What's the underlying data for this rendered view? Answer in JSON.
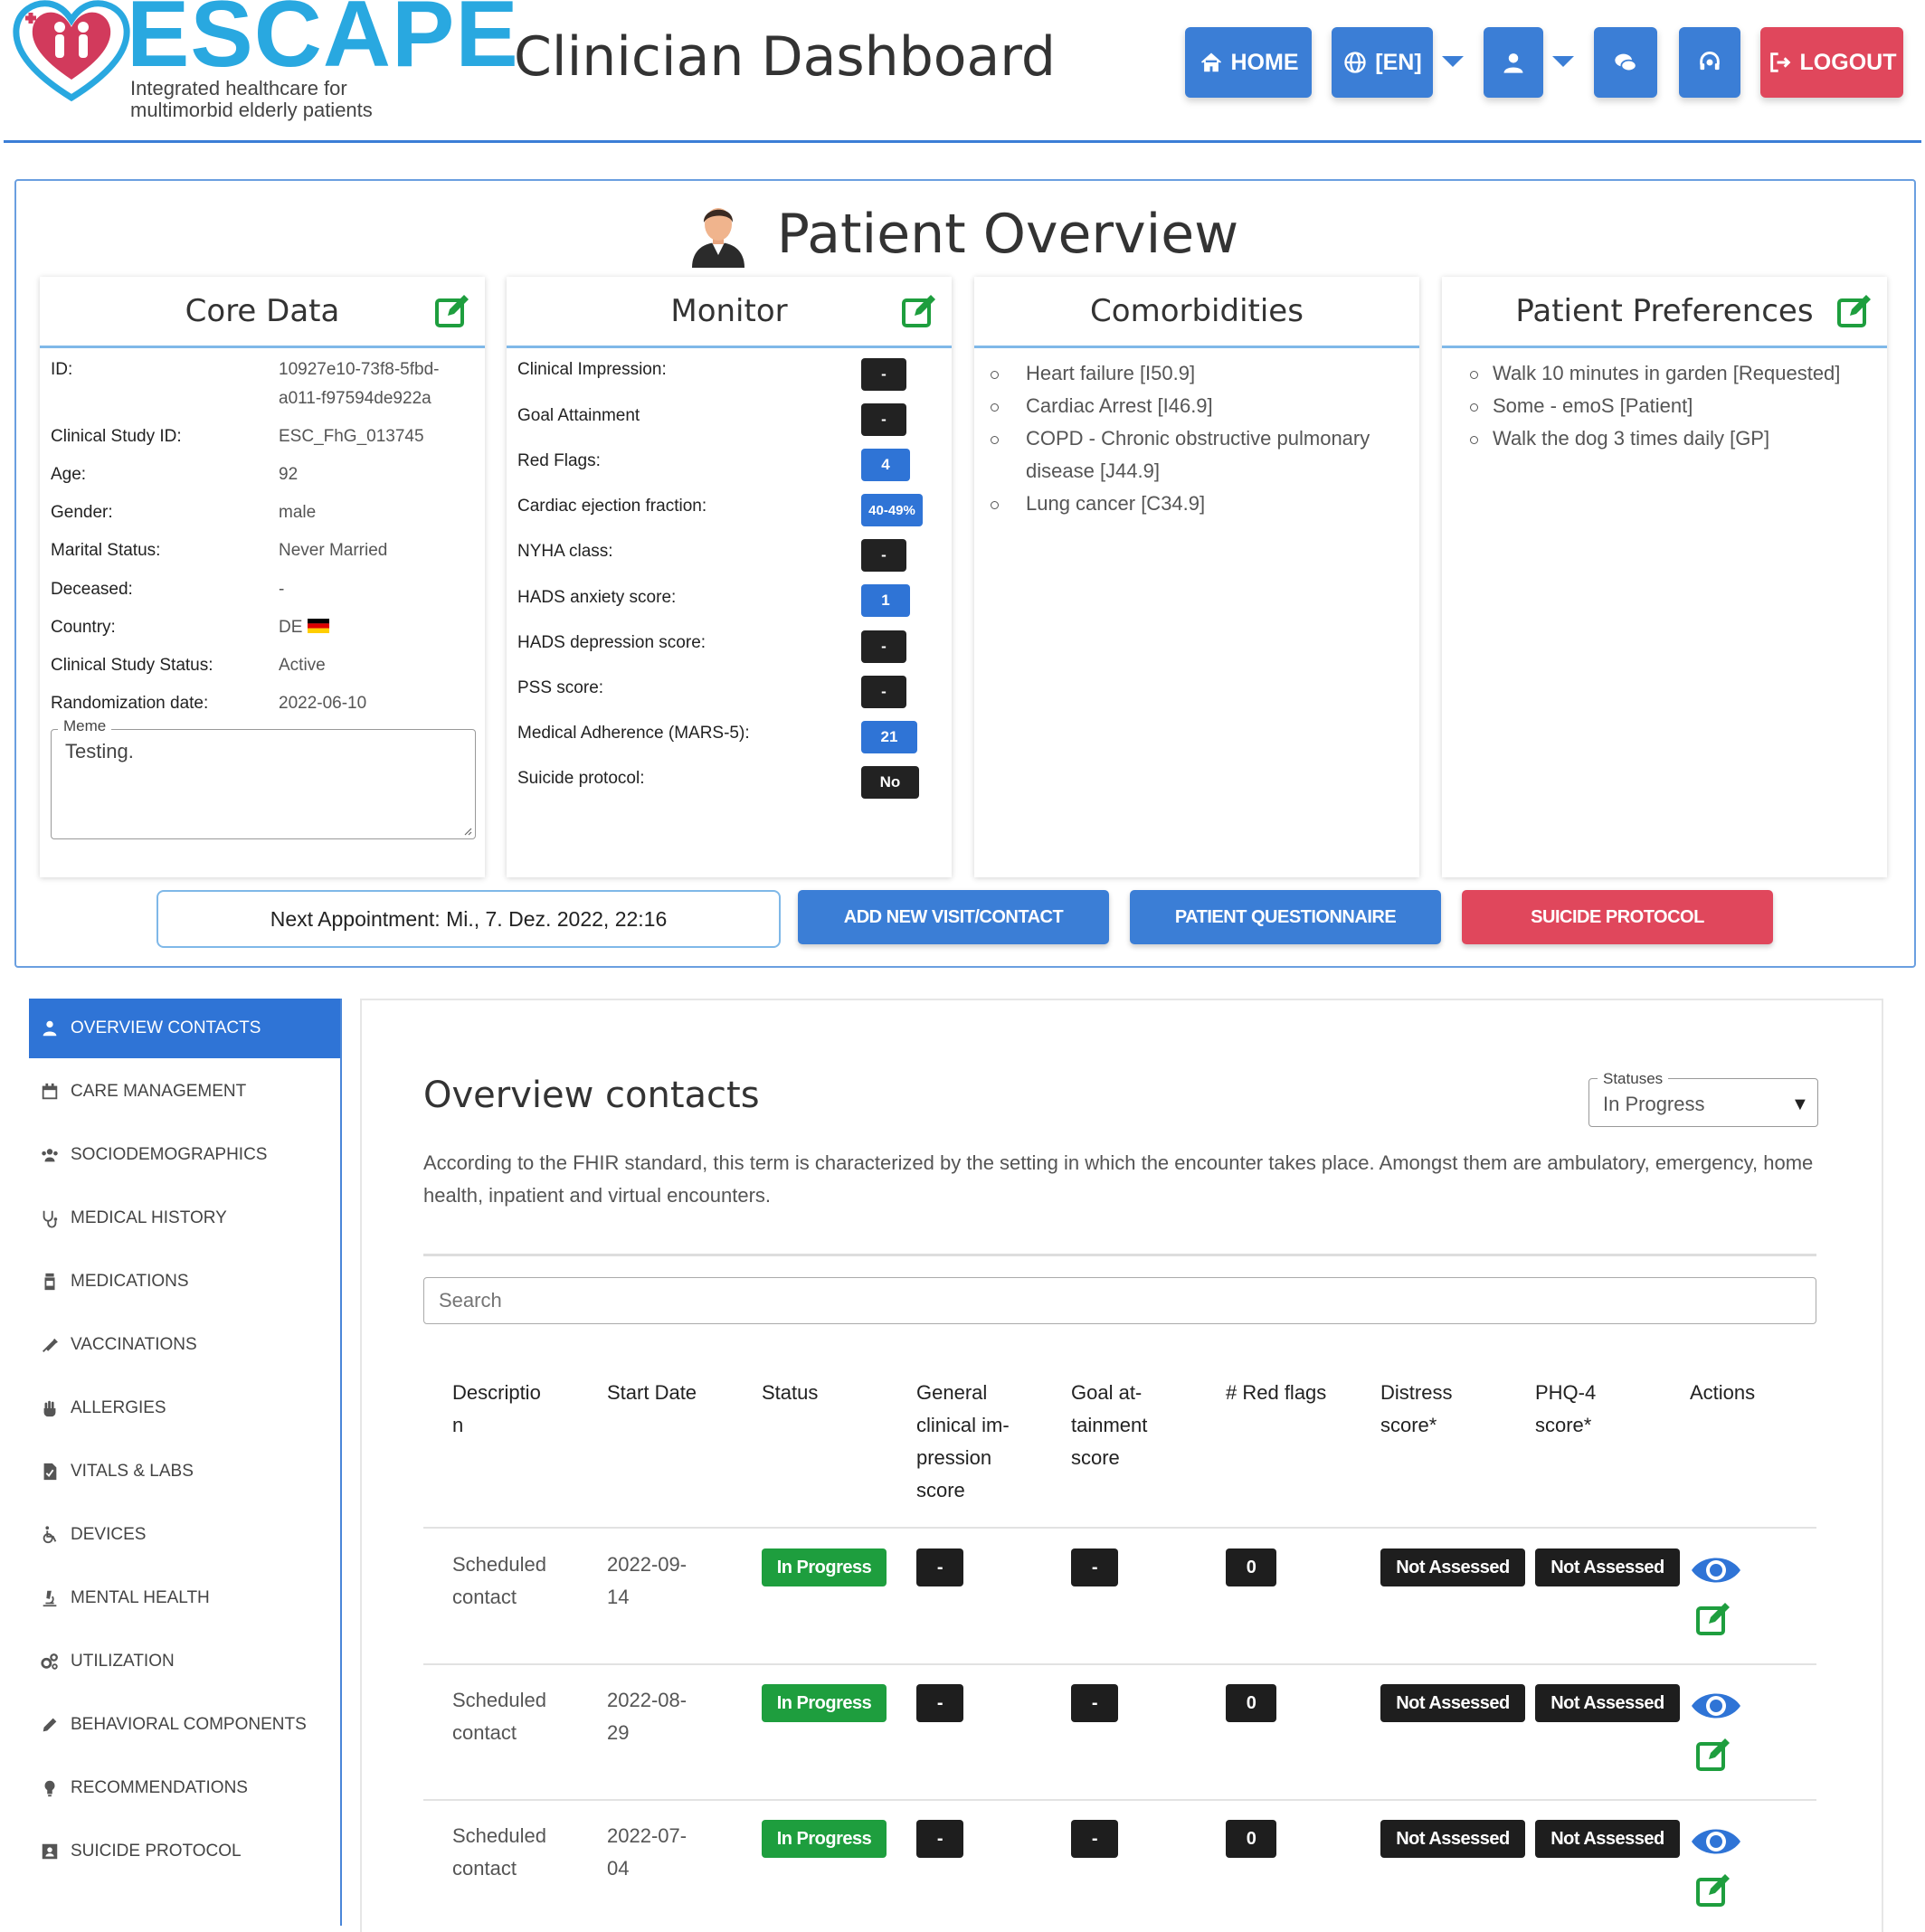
{
  "header": {
    "brand": "ESCAPE",
    "tagline_line1": "Integrated healthcare for",
    "tagline_line2": "multimorbid elderly patients",
    "title": "Clinician Dashboard",
    "home_label": "HOME",
    "language_label": "[EN]",
    "logout_label": "LOGOUT"
  },
  "colors": {
    "primary": "#3b7ed6",
    "brand_blue": "#29a8e0",
    "danger": "#e0475c",
    "success": "#1e9e3e",
    "dark_badge": "#222222"
  },
  "overview": {
    "title": "Patient Overview",
    "core": {
      "title": "Core Data",
      "rows": [
        {
          "label": "ID:",
          "value": "10927e10-73f8-5fbd-",
          "value2": "a011-f97594de922a"
        },
        {
          "label": "Clinical Study ID:",
          "value": "ESC_FhG_013745"
        },
        {
          "label": "Age:",
          "value": "92"
        },
        {
          "label": "Gender:",
          "value": "male"
        },
        {
          "label": "Marital Status:",
          "value": "Never Married"
        },
        {
          "label": "Deceased:",
          "value": "-"
        },
        {
          "label": "Country:",
          "value": "DE"
        },
        {
          "label": "Clinical Study Status:",
          "value": "Active"
        },
        {
          "label": "Randomization date:",
          "value": "2022-06-10"
        }
      ],
      "meme_label": "Meme",
      "meme_text": "Testing."
    },
    "monitor": {
      "title": "Monitor",
      "rows": [
        {
          "label": "Clinical Impression:",
          "value": "-"
        },
        {
          "label": "Goal Attainment",
          "value": "-"
        },
        {
          "label": "Red Flags:",
          "value": "4"
        },
        {
          "label": "Cardiac ejection fraction:",
          "value": "40-49%"
        },
        {
          "label": "NYHA class:",
          "value": "-"
        },
        {
          "label": "HADS anxiety score:",
          "value": "1"
        },
        {
          "label": "HADS depression score:",
          "value": "-"
        },
        {
          "label": "PSS score:",
          "value": "-"
        },
        {
          "label": "Medical Adherence (MARS-5):",
          "value": "21"
        },
        {
          "label": "Suicide protocol:",
          "value": "No"
        }
      ]
    },
    "comorbidities": {
      "title": "Comorbidities",
      "items": [
        "Heart failure [I50.9]",
        "Cardiac Arrest [I46.9]",
        "COPD - Chronic obstructive pulmonary",
        "disease [J44.9]",
        "Lung cancer [C34.9]"
      ]
    },
    "preferences": {
      "title": "Patient Preferences",
      "items": [
        "Walk 10 minutes in garden [Requested]",
        "Some - emoS [Patient]",
        "Walk the dog 3 times daily [GP]"
      ]
    },
    "next_appointment": "Next Appointment: Mi., 7. Dez. 2022, 22:16",
    "add_visit_label": "ADD NEW VISIT/CONTACT",
    "questionnaire_label": "PATIENT QUESTIONNAIRE",
    "suicide_label": "SUICIDE PROTOCOL"
  },
  "sidebar": {
    "items": [
      {
        "label": "OVERVIEW CONTACTS",
        "icon": "person-icon",
        "active": true
      },
      {
        "label": "CARE MANAGEMENT",
        "icon": "calendar-icon"
      },
      {
        "label": "SOCIODEMOGRAPHICS",
        "icon": "users-icon"
      },
      {
        "label": "MEDICAL HISTORY",
        "icon": "stethoscope-icon"
      },
      {
        "label": "MEDICATIONS",
        "icon": "pill-bottle-icon"
      },
      {
        "label": "VACCINATIONS",
        "icon": "syringe-icon"
      },
      {
        "label": "ALLERGIES",
        "icon": "hand-icon"
      },
      {
        "label": "VITALS & LABS",
        "icon": "lab-file-icon"
      },
      {
        "label": "DEVICES",
        "icon": "wheelchair-icon"
      },
      {
        "label": "MENTAL HEALTH",
        "icon": "microscope-icon"
      },
      {
        "label": "UTILIZATION",
        "icon": "gears-icon"
      },
      {
        "label": "BEHAVIORAL COMPONENTS",
        "icon": "pencil-icon"
      },
      {
        "label": "RECOMMENDATIONS",
        "icon": "lightbulb-icon"
      },
      {
        "label": "SUICIDE PROTOCOL",
        "icon": "id-card-icon"
      }
    ]
  },
  "contacts": {
    "title": "Overview contacts",
    "status_label": "Statuses",
    "status_value": "In Progress",
    "description": "According to the FHIR standard, this term is characterized by the setting in which the encounter takes place. Amongst them are ambulatory, emergency, home health, inpatient and virtual encounters.",
    "search_placeholder": "Search",
    "columns": [
      [
        "Descriptio",
        "n"
      ],
      [
        "Start Date"
      ],
      [
        "Status"
      ],
      [
        "General",
        "clinical im-",
        "pression",
        "score"
      ],
      [
        "Goal at-",
        "tainment",
        "score"
      ],
      [
        "# Red flags"
      ],
      [
        "Distress",
        "score*"
      ],
      [
        "PHQ-4",
        "score*"
      ],
      [
        "Actions"
      ]
    ],
    "rows": [
      {
        "description": [
          "Scheduled",
          "contact"
        ],
        "start_date": [
          "2022-09-",
          "14"
        ],
        "status": "In Progress",
        "general": "-",
        "goal": "-",
        "red_flags": "0",
        "distress": "Not Assessed",
        "phq4": "Not Assessed"
      },
      {
        "description": [
          "Scheduled",
          "contact"
        ],
        "start_date": [
          "2022-08-",
          "29"
        ],
        "status": "In Progress",
        "general": "-",
        "goal": "-",
        "red_flags": "0",
        "distress": "Not Assessed",
        "phq4": "Not Assessed"
      },
      {
        "description": [
          "Scheduled",
          "contact"
        ],
        "start_date": [
          "2022-07-",
          "04"
        ],
        "status": "In Progress",
        "general": "-",
        "goal": "-",
        "red_flags": "0",
        "distress": "Not Assessed",
        "phq4": "Not Assessed"
      }
    ]
  }
}
